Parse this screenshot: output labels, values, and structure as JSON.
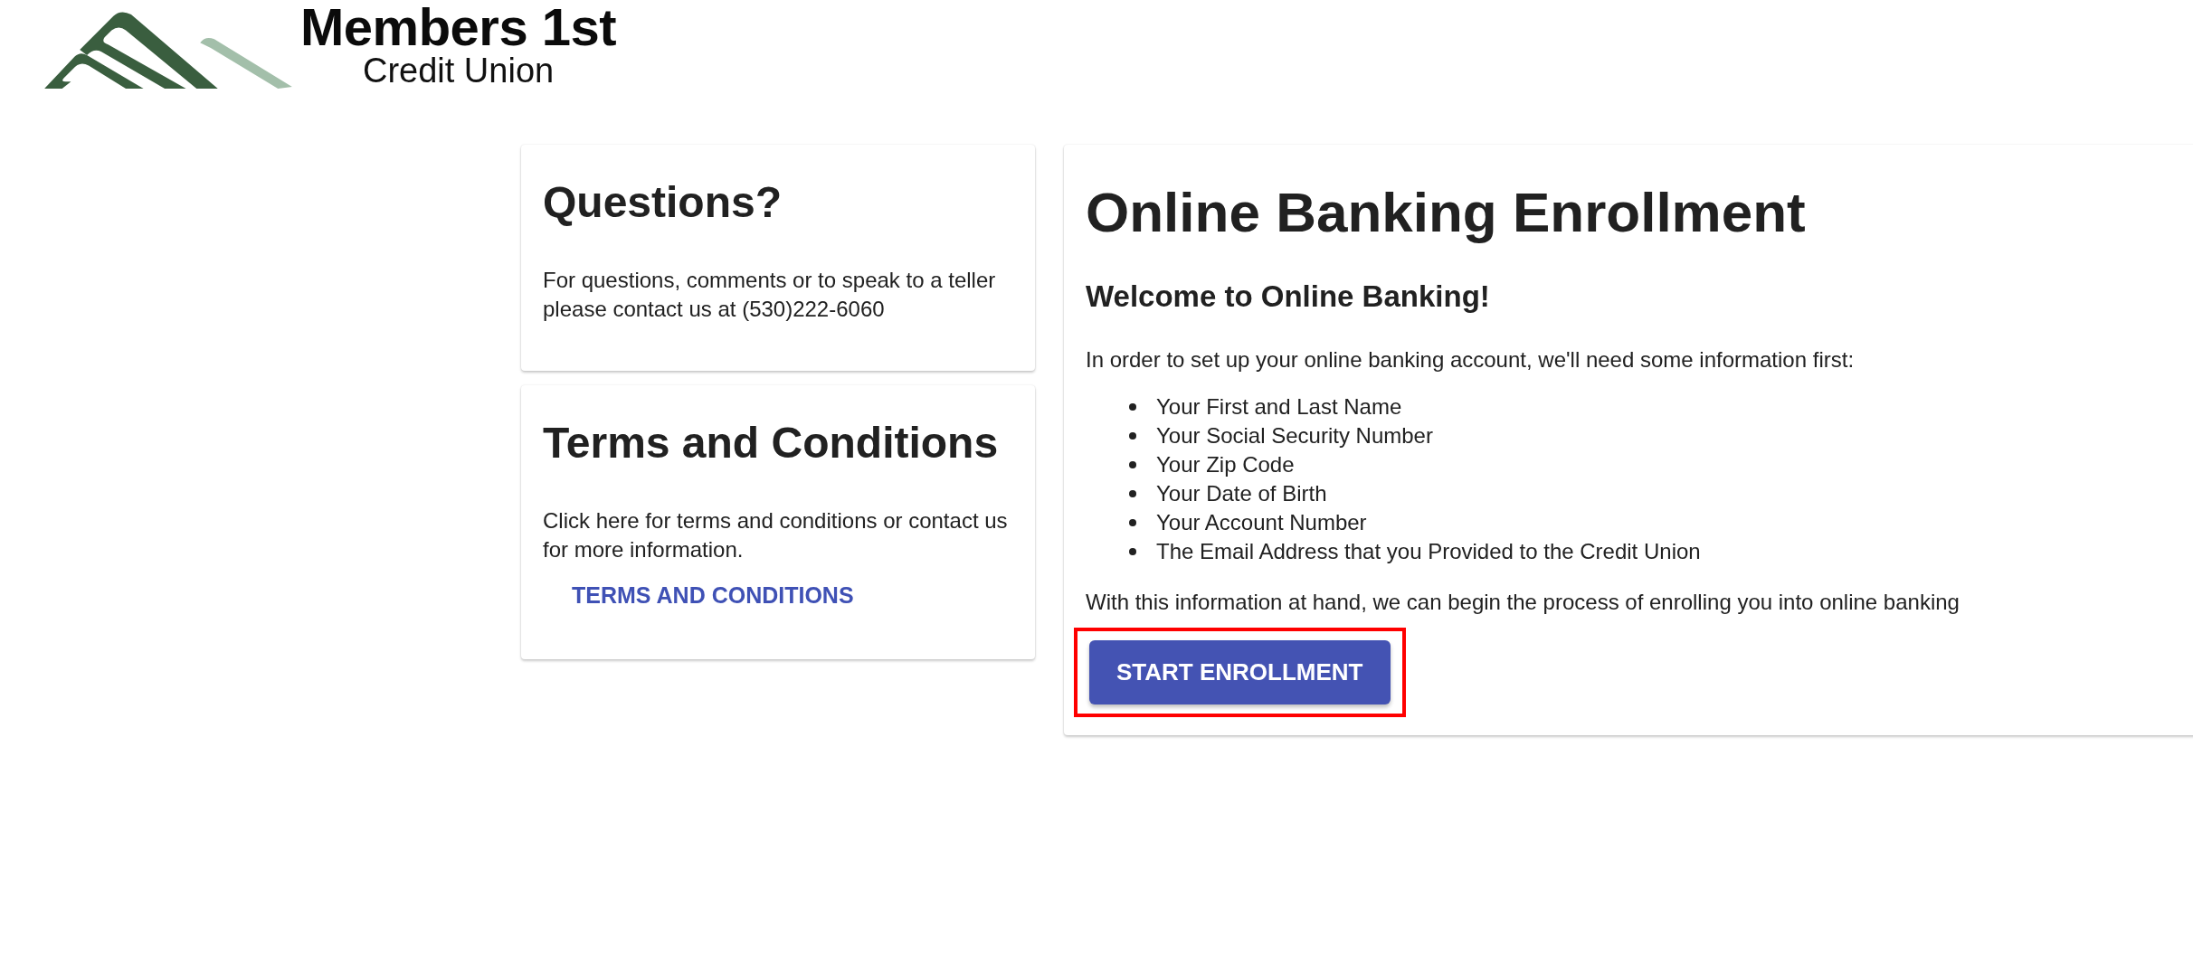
{
  "logo": {
    "name": "Members 1st",
    "subtitle": "Credit Union"
  },
  "questions_card": {
    "title": "Questions?",
    "text": "For questions, comments or to speak to a teller please contact us at (530)222-6060"
  },
  "terms_card": {
    "title": "Terms and Conditions",
    "text": "Click here for terms and conditions or contact us for more information.",
    "link": "TERMS AND CONDITIONS"
  },
  "enrollment": {
    "title": "Online Banking Enrollment",
    "subtitle": "Welcome to Online Banking!",
    "intro": "In order to set up your online banking account, we'll need some information first:",
    "requirements": [
      "Your First and Last Name",
      "Your Social Security Number",
      "Your Zip Code",
      "Your Date of Birth",
      "Your Account Number",
      "The Email Address that you Provided to the Credit Union"
    ],
    "closing": "With this information at hand, we can begin the process of enrolling you into online banking",
    "button": {
      "label": "START ENROLLMENT",
      "highlighted": true
    }
  }
}
